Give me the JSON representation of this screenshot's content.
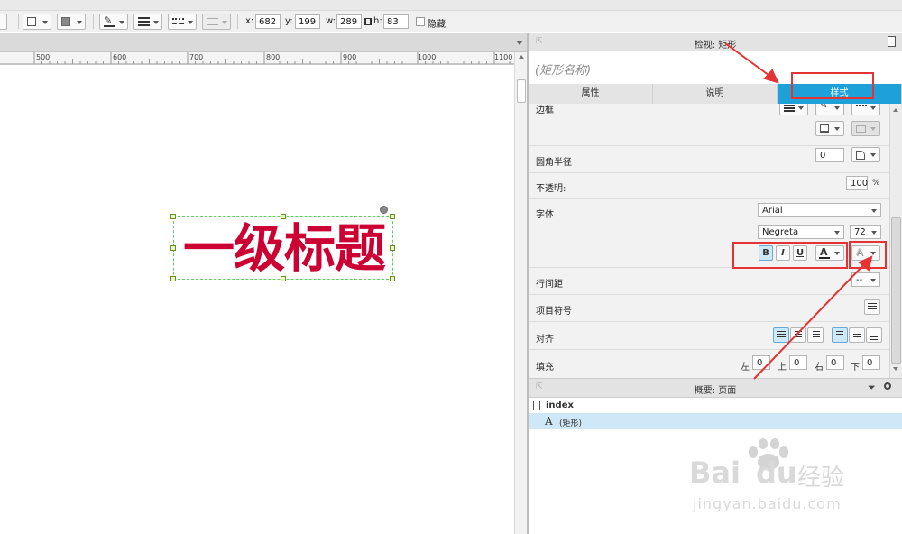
{
  "toolbar": {
    "x_label": "x:",
    "x_value": "682",
    "y_label": "y:",
    "y_value": "199",
    "w_label": "w:",
    "w_value": "289",
    "h_label": "h:",
    "h_value": "83",
    "hidden_label": "隐藏"
  },
  "ruler": {
    "ticks": [
      "500",
      "600",
      "700",
      "800",
      "900",
      "1000",
      "1100"
    ]
  },
  "canvas": {
    "widget_text": "一级标题"
  },
  "inspector": {
    "title": "检视: 矩形",
    "shape_name_placeholder": "(矩形名称)",
    "tabs": [
      {
        "label": "属性"
      },
      {
        "label": "说明"
      },
      {
        "label": "样式"
      }
    ],
    "rows": {
      "border_label": "边框",
      "radius_label": "圆角半径",
      "radius_value": "0",
      "opacity_label": "不透明:",
      "opacity_value": "100",
      "opacity_unit": "%",
      "font_label": "字体",
      "font_family": "Arial",
      "font_style": "Negreta",
      "font_size": "72",
      "bold": "B",
      "italic": "I",
      "underline": "U",
      "font_color_glyph": "A",
      "text_shadow_glyph": "A",
      "line_spacing_label": "行间距",
      "line_spacing_value": "--",
      "bullets_label": "项目符号",
      "align_label": "对齐",
      "padding_label": "填充",
      "pad_left_label": "左",
      "pad_left": "0",
      "pad_top_label": "上",
      "pad_top": "0",
      "pad_right_label": "右",
      "pad_right": "0",
      "pad_bottom_label": "下",
      "pad_bottom": "0"
    }
  },
  "outline": {
    "title": "概要: 页面",
    "items": [
      {
        "icon": "page-icon",
        "label": "index"
      },
      {
        "icon": "text-icon",
        "glyph": "A",
        "label": "(矩形)"
      }
    ]
  },
  "watermark": {
    "brand_a": "Bai",
    "brand_b": "du",
    "brand_cn": "经验",
    "url": "jingyan.baidu.com"
  },
  "colors": {
    "accent_tab": "#1ea0d8",
    "widget_text": "#cc0033",
    "annotation": "#e53333",
    "selection_row": "#cfe8f7"
  }
}
